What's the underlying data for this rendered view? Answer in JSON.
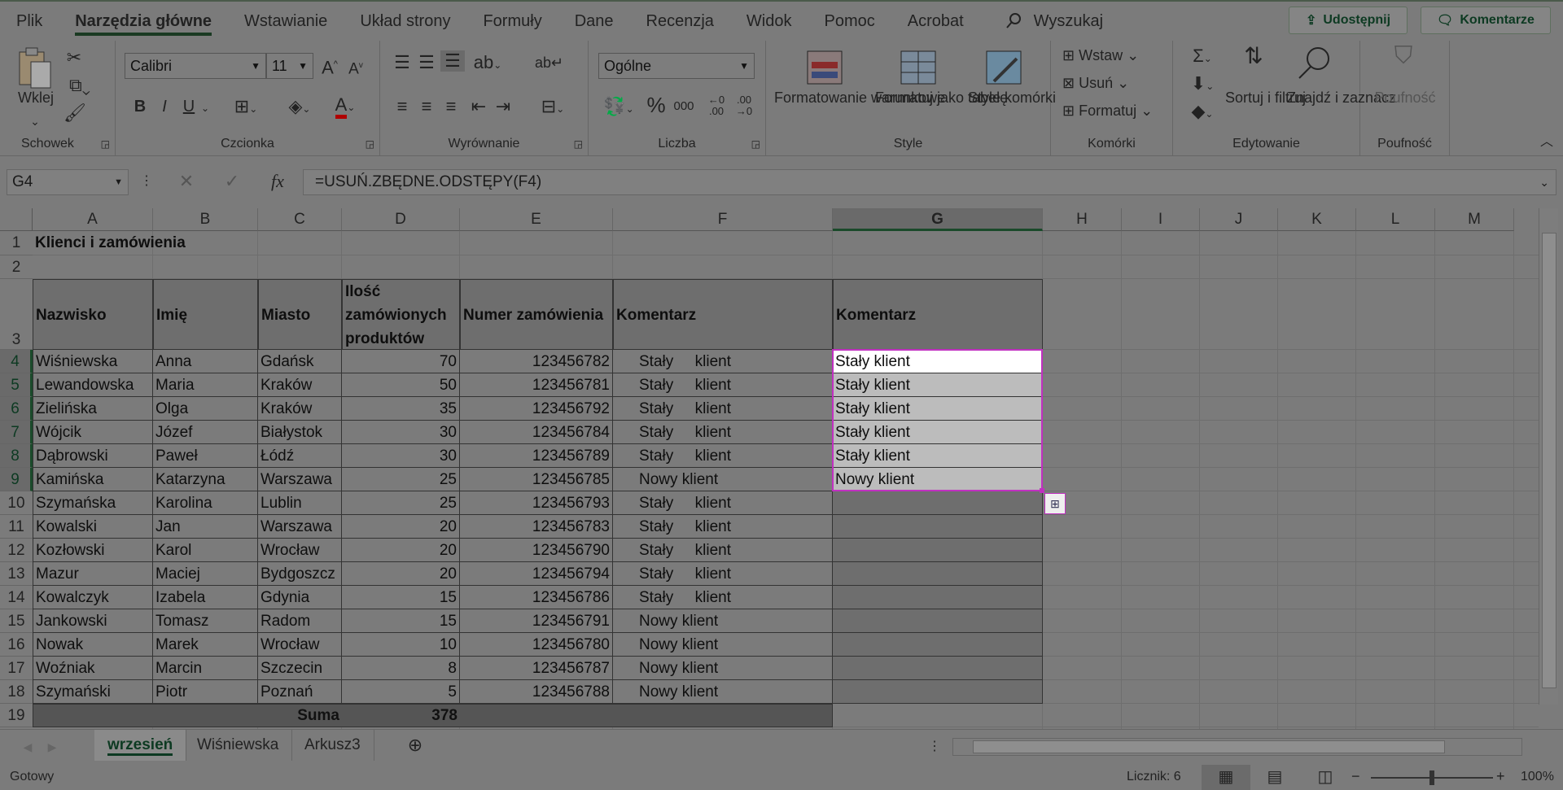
{
  "menu": {
    "tabs": [
      "Plik",
      "Narzędzia główne",
      "Wstawianie",
      "Układ strony",
      "Formuły",
      "Dane",
      "Recenzja",
      "Widok",
      "Pomoc",
      "Acrobat"
    ],
    "search": "Wyszukaj",
    "share": "Udostępnij",
    "comments": "Komentarze"
  },
  "ribbon": {
    "clipboard": {
      "paste": "Wklej",
      "label": "Schowek"
    },
    "font": {
      "name": "Calibri",
      "size": "11",
      "bold": "B",
      "italic": "I",
      "underline": "U",
      "label": "Czcionka",
      "font_color": "#c00000"
    },
    "alignment": {
      "label": "Wyrównanie"
    },
    "number": {
      "format": "Ogólne",
      "percent": "%",
      "thousands": "000",
      "label": "Liczba"
    },
    "styles": {
      "cond": "Formatowanie warunkowe",
      "table": "Formatuj jako tabelę",
      "cell": "Style komórki",
      "label": "Style"
    },
    "cells": {
      "insert": "Wstaw",
      "delete": "Usuń",
      "format": "Formatuj",
      "label": "Komórki"
    },
    "editing": {
      "sort": "Sortuj i filtruj",
      "find": "Znajdź i zaznacz",
      "label": "Edytowanie"
    },
    "sensitivity": {
      "button": "Poufność",
      "label": "Poufność"
    }
  },
  "formula_bar": {
    "name_box": "G4",
    "formula": "=USUŃ.ZBĘDNE.ODSTĘPY(F4)",
    "fx": "fx"
  },
  "columns": [
    "A",
    "B",
    "C",
    "D",
    "E",
    "F",
    "G",
    "H",
    "I",
    "J",
    "K",
    "L",
    "M"
  ],
  "sheet": {
    "title": "Klienci i zamówienia",
    "headers": [
      "Nazwisko",
      "Imię",
      "Miasto",
      "Ilość zamówionych produktów",
      "Numer zamówienia",
      "Komentarz",
      "Komentarz"
    ],
    "rows": [
      [
        "Wiśniewska",
        "Anna",
        "Gdańsk",
        "70",
        "123456782",
        "Stały     klient",
        "Stały klient"
      ],
      [
        "Lewandowska",
        "Maria",
        "Kraków",
        "50",
        "123456781",
        "Stały     klient",
        "Stały klient"
      ],
      [
        "Zielińska",
        "Olga",
        "Kraków",
        "35",
        "123456792",
        "Stały     klient",
        "Stały klient"
      ],
      [
        "Wójcik",
        "Józef",
        "Białystok",
        "30",
        "123456784",
        "Stały     klient",
        "Stały klient"
      ],
      [
        "Dąbrowski",
        "Paweł",
        "Łódź",
        "30",
        "123456789",
        "Stały     klient",
        "Stały klient"
      ],
      [
        "Kamińska",
        "Katarzyna",
        "Warszawa",
        "25",
        "123456785",
        "Nowy klient",
        "Nowy klient"
      ],
      [
        "Szymańska",
        "Karolina",
        "Lublin",
        "25",
        "123456793",
        "Stały     klient",
        ""
      ],
      [
        "Kowalski",
        "Jan",
        "Warszawa",
        "20",
        "123456783",
        "Stały     klient",
        ""
      ],
      [
        "Kozłowski",
        "Karol",
        "Wrocław",
        "20",
        "123456790",
        "Stały     klient",
        ""
      ],
      [
        "Mazur",
        "Maciej",
        "Bydgoszcz",
        "20",
        "123456794",
        "Stały     klient",
        ""
      ],
      [
        "Kowalczyk",
        "Izabela",
        "Gdynia",
        "15",
        "123456786",
        "Stały     klient",
        ""
      ],
      [
        "Jankowski",
        "Tomasz",
        "Radom",
        "15",
        "123456791",
        "Nowy klient",
        ""
      ],
      [
        "Nowak",
        "Marek",
        "Wrocław",
        "10",
        "123456780",
        "Nowy klient",
        ""
      ],
      [
        "Woźniak",
        "Marcin",
        "Szczecin",
        "8",
        "123456787",
        "Nowy klient",
        ""
      ],
      [
        "Szymański",
        "Piotr",
        "Poznań",
        "5",
        "123456788",
        "Nowy klient",
        ""
      ]
    ],
    "sum_label": "Suma",
    "sum_value": "378"
  },
  "row_numbers": [
    "1",
    "2",
    "3",
    "4",
    "5",
    "6",
    "7",
    "8",
    "9",
    "10",
    "11",
    "12",
    "13",
    "14",
    "15",
    "16",
    "17",
    "18",
    "19"
  ],
  "sheet_tabs": [
    "wrzesień",
    "Wiśniewska",
    "Arkusz3"
  ],
  "status": {
    "ready": "Gotowy",
    "count": "Licznik: 6",
    "zoom": "100%"
  }
}
